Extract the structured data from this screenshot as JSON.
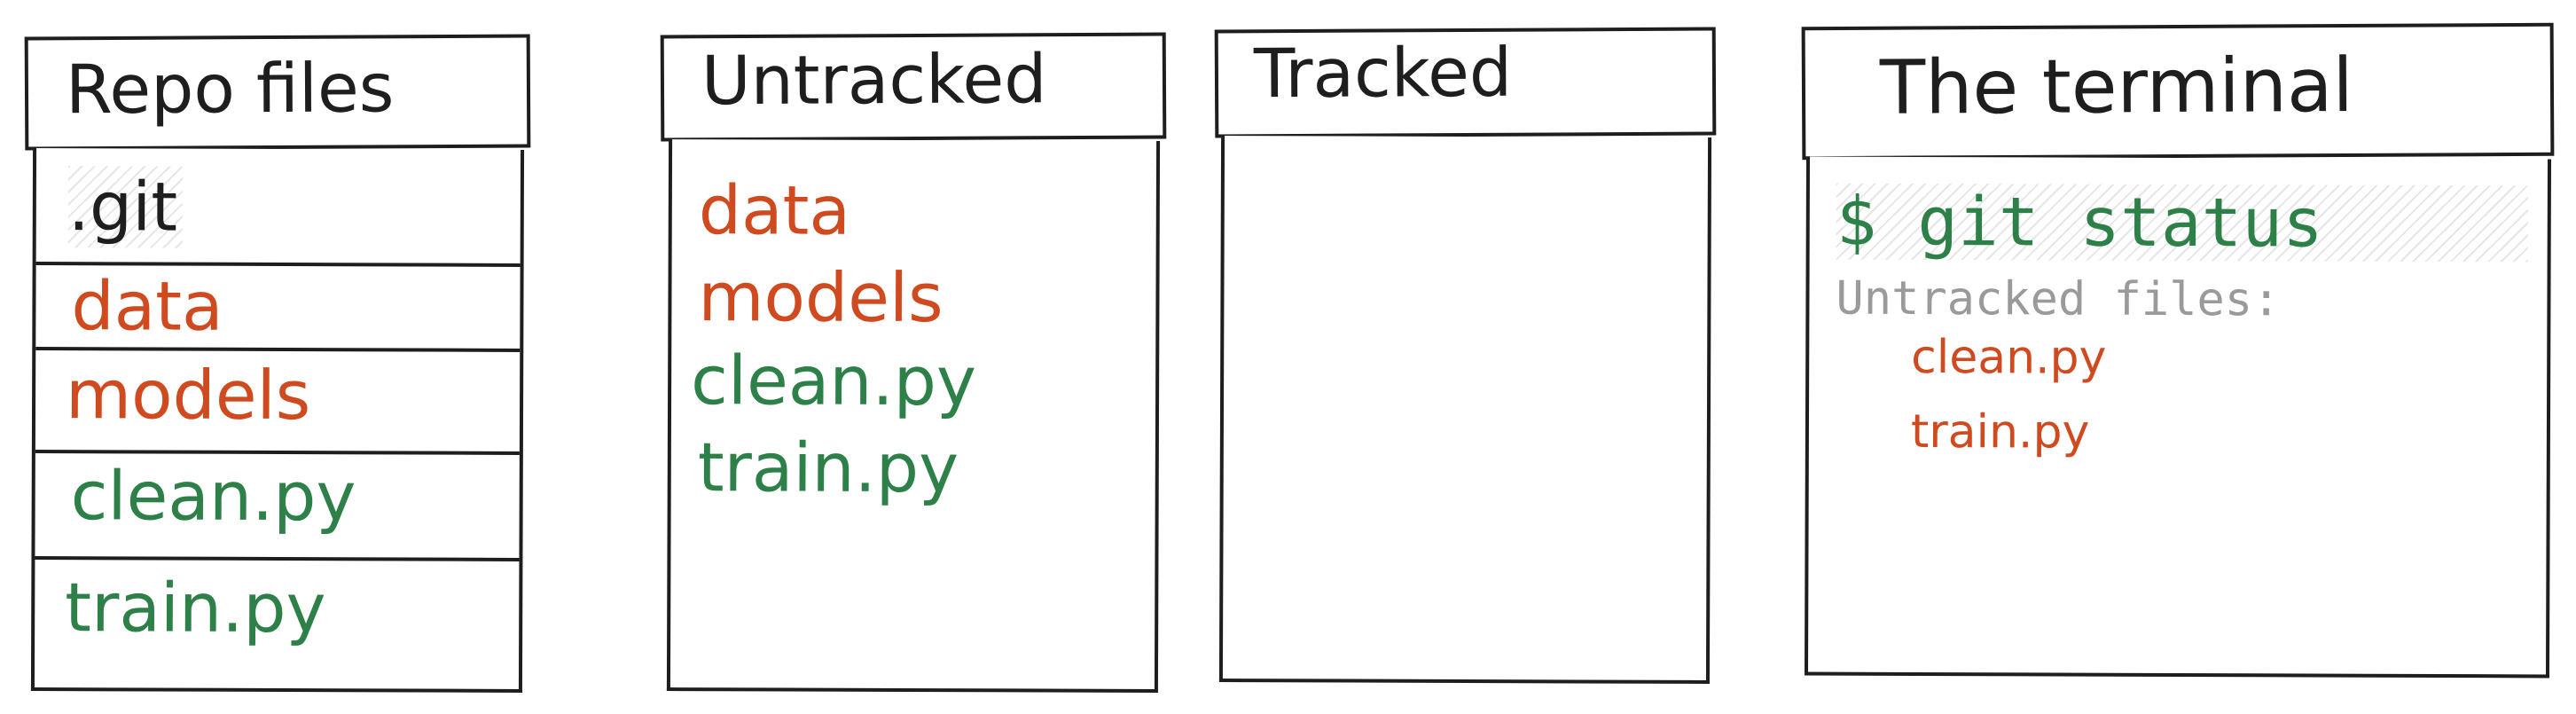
{
  "panels": {
    "repo": {
      "title": "Repo files",
      "items": [
        ".git",
        "data",
        "models",
        "clean.py",
        "train.py"
      ]
    },
    "untracked": {
      "title": "Untracked",
      "items": [
        "data",
        "models",
        "clean.py",
        "train.py"
      ]
    },
    "tracked": {
      "title": "Tracked",
      "items": []
    },
    "terminal": {
      "title": "The terminal",
      "command": "$ git status",
      "label": "Untracked files:",
      "files": [
        "clean.py",
        "train.py"
      ]
    }
  },
  "colors": {
    "untracked_folder": "#d04a1f",
    "untracked_file": "#2e8049",
    "ink": "#1e1e1e",
    "muted": "#9a9a9a"
  }
}
